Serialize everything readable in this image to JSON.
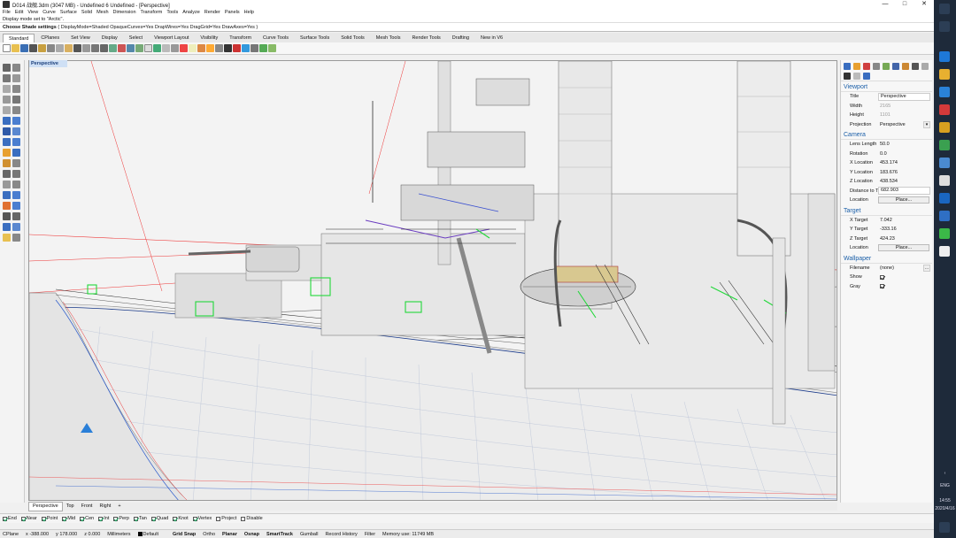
{
  "window": {
    "title": "D014 战舰.3dm (3047 MB) - Undefined 6 Undefined - [Perspective]",
    "minimize": "—",
    "maximize": "□",
    "close": "✕"
  },
  "menu": [
    "File",
    "Edit",
    "View",
    "Curve",
    "Surface",
    "Solid",
    "Mesh",
    "Dimension",
    "Transform",
    "Tools",
    "Analyze",
    "Render",
    "Panels",
    "Help"
  ],
  "command": {
    "history": "Display mode set to \"Arctic\".",
    "prompt": "Choose Shade settings",
    "options": "( DisplayMode=Shaded  OpaqueCurves=Yes  DrapWires=Yes  DragGrid=Yes  DrawAxes=Yes )"
  },
  "toolbar_tabs": [
    "Standard",
    "CPlanes",
    "Set View",
    "Display",
    "Select",
    "Viewport Layout",
    "Visibility",
    "Transform",
    "Curve Tools",
    "Surface Tools",
    "Solid Tools",
    "Mesh Tools",
    "Render Tools",
    "Drafting",
    "New in V6"
  ],
  "viewport": {
    "title": "Perspective",
    "tabs": [
      "Perspective",
      "Top",
      "Front",
      "Right"
    ],
    "add_tab": "+"
  },
  "osnaps": [
    {
      "label": "End",
      "on": true
    },
    {
      "label": "Near",
      "on": true
    },
    {
      "label": "Point",
      "on": true
    },
    {
      "label": "Mid",
      "on": true
    },
    {
      "label": "Cen",
      "on": true
    },
    {
      "label": "Int",
      "on": true
    },
    {
      "label": "Perp",
      "on": true
    },
    {
      "label": "Tan",
      "on": true
    },
    {
      "label": "Quad",
      "on": true
    },
    {
      "label": "Knot",
      "on": true
    },
    {
      "label": "Vertex",
      "on": true
    },
    {
      "label": "Project",
      "on": false
    },
    {
      "label": "Disable",
      "on": false
    }
  ],
  "status": {
    "cplane": "CPlane",
    "x": "x -388.000",
    "y": "y 178.000",
    "z": "z 0.000",
    "units": "Millimeters",
    "layer": "Default",
    "grid_snap": "Grid Snap",
    "ortho": "Ortho",
    "planar": "Planar",
    "osnap": "Osnap",
    "smarttrack": "SmartTrack",
    "gumball": "Gumball",
    "record_history": "Record History",
    "filter": "Filter",
    "memory": "Memory use: 11749 MB"
  },
  "properties": {
    "viewport": {
      "header": "Viewport",
      "title_label": "Title",
      "title_value": "Perspective",
      "width_label": "Width",
      "width_value": "2165",
      "height_label": "Height",
      "height_value": "1101",
      "projection_label": "Projection",
      "projection_value": "Perspective"
    },
    "camera": {
      "header": "Camera",
      "lens_label": "Lens Length",
      "lens_value": "50.0",
      "rotation_label": "Rotation",
      "rotation_value": "0.0",
      "xloc_label": "X Location",
      "xloc_value": "453.174",
      "yloc_label": "Y Location",
      "yloc_value": "183.676",
      "zloc_label": "Z Location",
      "zloc_value": "438.534",
      "dist_label": "Distance to T...",
      "dist_value": "682.903",
      "loc_label": "Location",
      "loc_button": "Place..."
    },
    "target": {
      "header": "Target",
      "xt_label": "X Target",
      "xt_value": "7.042",
      "yt_label": "Y Target",
      "yt_value": "-333.16",
      "zt_label": "Z Target",
      "zt_value": "424.23",
      "loc_label": "Location",
      "loc_button": "Place..."
    },
    "wallpaper": {
      "header": "Wallpaper",
      "file_label": "Filename",
      "file_value": "(none)",
      "show_label": "Show",
      "show_on": true,
      "gray_label": "Gray",
      "gray_on": true
    }
  },
  "taskbar": {
    "lang": "ENG",
    "time": "14:55",
    "date": "2020/4/16"
  }
}
